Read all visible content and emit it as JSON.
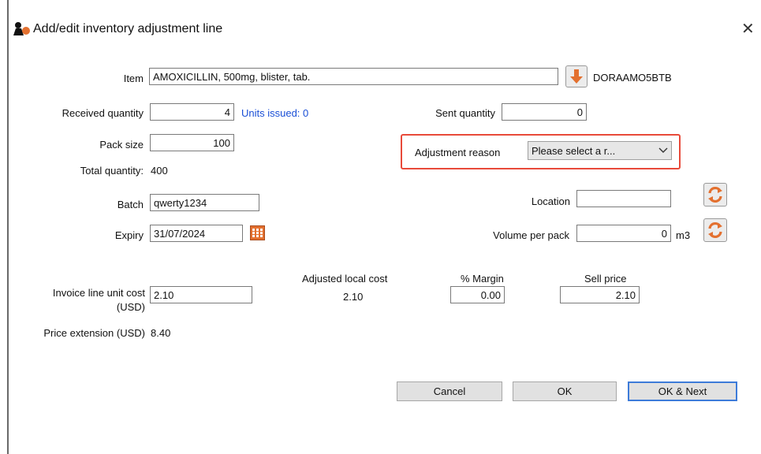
{
  "window": {
    "title": "Add/edit inventory adjustment line",
    "close_glyph": "✕"
  },
  "item": {
    "label": "Item",
    "value": "AMOXICILLIN, 500mg, blister, tab.",
    "code": "DORAAMO5BTB"
  },
  "received": {
    "label": "Received quantity",
    "value": "4",
    "units_issued": "Units issued: 0"
  },
  "sent": {
    "label": "Sent quantity",
    "value": "0"
  },
  "pack_size": {
    "label": "Pack size",
    "value": "100"
  },
  "adjustment_reason": {
    "label": "Adjustment reason",
    "value": "Please select a r..."
  },
  "total_quantity": {
    "label": "Total quantity:",
    "value": "400"
  },
  "batch": {
    "label": "Batch",
    "value": "qwerty1234"
  },
  "location": {
    "label": "Location",
    "value": ""
  },
  "expiry": {
    "label": "Expiry",
    "value": "31/07/2024"
  },
  "volume": {
    "label": "Volume per pack",
    "value": "0",
    "unit": "m3"
  },
  "cost": {
    "invoice_label_1": "Invoice line unit cost",
    "invoice_label_2": "(USD)",
    "invoice_value": "2.10",
    "adjusted_label": "Adjusted local cost",
    "adjusted_value": "2.10",
    "margin_label": "% Margin",
    "margin_value": "0.00",
    "sell_label": "Sell price",
    "sell_value": "2.10"
  },
  "price_extension": {
    "label": "Price extension (USD)",
    "value": "8.40"
  },
  "buttons": {
    "cancel": "Cancel",
    "ok": "OK",
    "ok_next": "OK & Next"
  },
  "colors": {
    "highlight": "#e84a3a",
    "link_blue": "#1a4fd6",
    "icon_orange": "#e3702f",
    "default_button_border": "#3d7bd9"
  },
  "icons": [
    "app-icon",
    "close-icon",
    "arrow-down-icon",
    "refresh-icon",
    "calendar-icon",
    "chevron-down-icon"
  ]
}
